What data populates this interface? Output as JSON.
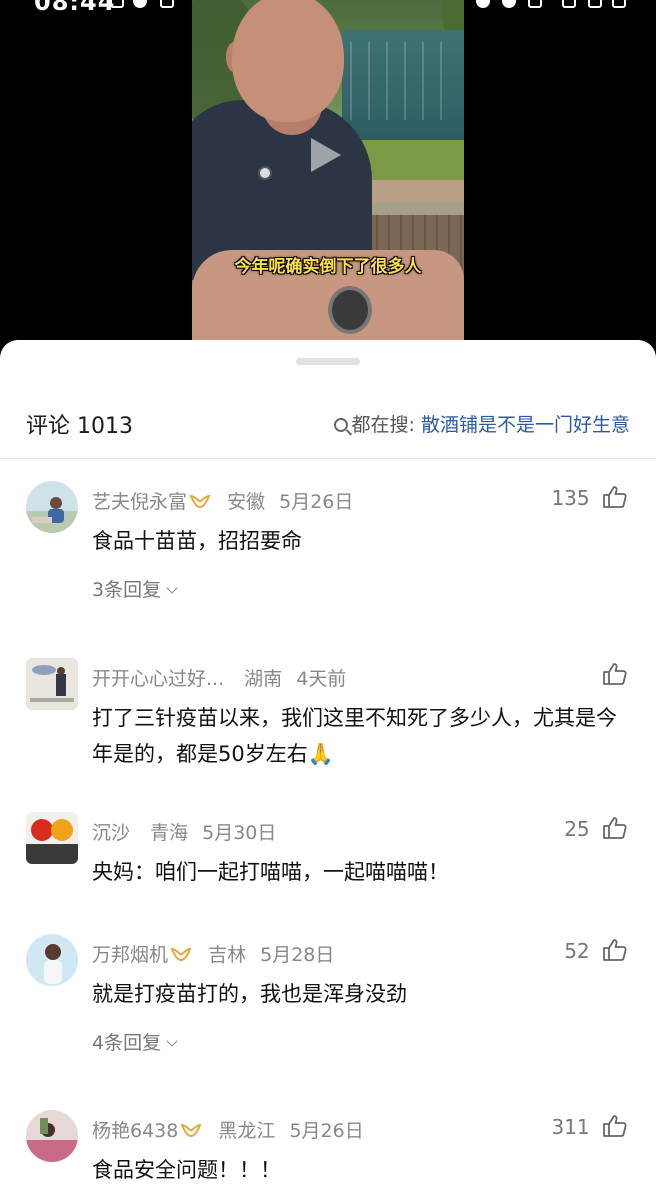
{
  "status_bar": {
    "time": "08:44"
  },
  "video": {
    "subtitle": "今年呢确实倒下了很多人"
  },
  "comments_panel": {
    "title": "评论 1013",
    "search_prefix": "都在搜:",
    "search_keyword": "散酒铺是不是一门好生意",
    "comments": [
      {
        "user": "艺夫倪永富",
        "vip": true,
        "location": "安徽",
        "date": "5月26日",
        "likes": "135",
        "text": "食品十苗苗，招招要命",
        "replies": "3条回复"
      },
      {
        "user": "开开心心过好...",
        "vip": false,
        "location": "湖南",
        "date": "4天前",
        "likes": "",
        "text": "打了三针疫苗以来，我们这里不知死了多少人，尤其是今年是的，都是50岁左右🙏",
        "replies": ""
      },
      {
        "user": "沉沙",
        "vip": false,
        "location": "青海",
        "date": "5月30日",
        "likes": "25",
        "text": "央妈：咱们一起打喵喵，一起喵喵喵！",
        "replies": ""
      },
      {
        "user": "万邦烟机",
        "vip": true,
        "location": "吉林",
        "date": "5月28日",
        "likes": "52",
        "text": "就是打疫苗打的，我也是浑身没劲",
        "replies": "4条回复"
      },
      {
        "user": "杨艳6438",
        "vip": true,
        "location": "黑龙江",
        "date": "5月26日",
        "likes": "311",
        "text": "食品安全问题！！！",
        "replies": ""
      }
    ]
  },
  "colors": {
    "link_blue": "#2e58a6",
    "vip_gold": "#e2a93b",
    "subtitle_yellow": "#ffe14d"
  },
  "icons": [
    "search-icon",
    "thumbs-up-icon",
    "vip-badge-icon",
    "chevron-down-icon",
    "play-icon"
  ]
}
